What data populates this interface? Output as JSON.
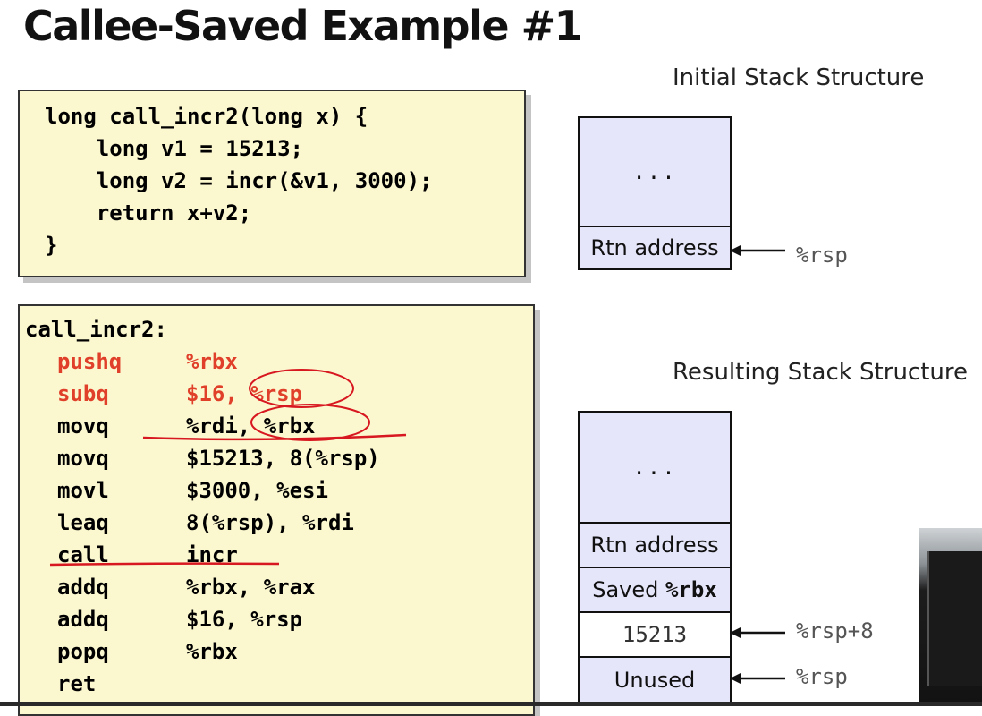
{
  "slide": {
    "title": "Callee-Saved Example #1"
  },
  "c_code": {
    "lines": [
      "long call_incr2(long x) {",
      "    long v1 = 15213;",
      "    long v2 = incr(&v1, 3000);",
      "    return x+v2;",
      "}"
    ]
  },
  "asm": {
    "label": "call_incr2:",
    "rows": [
      {
        "op": "pushq",
        "args": "%rbx",
        "highlight": true
      },
      {
        "op": "subq",
        "args": "$16, %rsp",
        "highlight": true
      },
      {
        "op": "movq",
        "args": "%rdi, %rbx",
        "highlight": false
      },
      {
        "op": "movq",
        "args": "$15213, 8(%rsp)",
        "highlight": false
      },
      {
        "op": "movl",
        "args": "$3000, %esi",
        "highlight": false
      },
      {
        "op": "leaq",
        "args": "8(%rsp), %rdi",
        "highlight": false
      },
      {
        "op": "call",
        "args": "incr",
        "highlight": false
      },
      {
        "op": "addq",
        "args": "%rbx, %rax",
        "highlight": false
      },
      {
        "op": "addq",
        "args": "$16, %rsp",
        "highlight": false
      },
      {
        "op": "popq",
        "args": "%rbx",
        "highlight": false
      },
      {
        "op": "ret",
        "args": "",
        "highlight": false
      }
    ],
    "highlight_color": "#e0402a",
    "annotation_color": "#d81820"
  },
  "initial_stack": {
    "caption": "Initial Stack Structure",
    "cells": [
      "...",
      "Rtn address"
    ],
    "pointer_label": "%rsp"
  },
  "resulting_stack": {
    "caption": "Resulting Stack Structure",
    "cells": [
      "...",
      "Rtn address",
      "Saved ",
      "%rbx",
      "15213",
      "Unused"
    ],
    "pointer_rsp8": "%rsp+8",
    "pointer_rsp": "%rsp"
  },
  "colors": {
    "code_bg": "#fbf7cf",
    "stack_bg": "#e6e6fb"
  }
}
